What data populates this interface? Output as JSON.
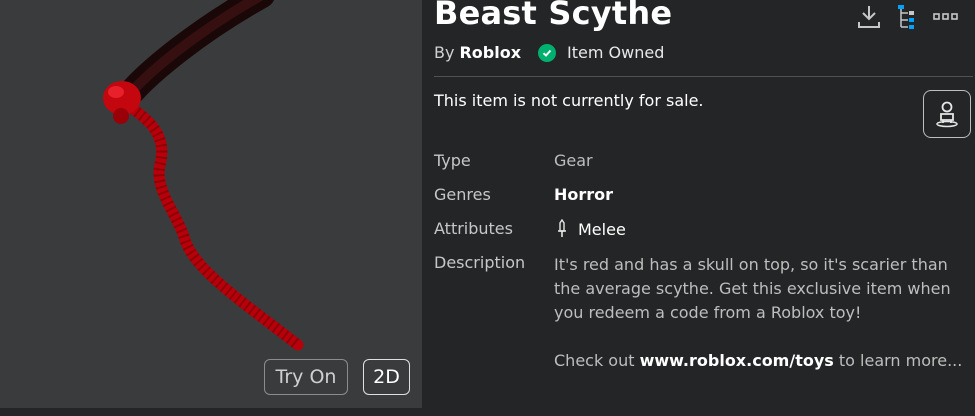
{
  "item": {
    "title": "Beast Scythe",
    "by_prefix": "By",
    "creator": "Roblox",
    "owned_label": "Item Owned",
    "sale_note": "This item is not currently for sale."
  },
  "preview": {
    "try_on_label": "Try On",
    "view_2d_label": "2D"
  },
  "details": {
    "type_label": "Type",
    "type_value": "Gear",
    "genres_label": "Genres",
    "genres_value": "Horror",
    "attributes_label": "Attributes",
    "attributes_value": "Melee",
    "description_label": "Description",
    "description_text": "It's red and has a skull on top, so it's scarier than the average scythe. Get this exclusive item when you redeem a code from a Roblox toy!",
    "more_prefix": "Check out ",
    "more_link": "www.roblox.com/toys",
    "more_suffix": " to learn more..."
  },
  "icons": {
    "download": "download-icon",
    "hierarchy": "hierarchy-icon",
    "more": "more-options-icon",
    "owned": "check-circle-icon",
    "avatar": "avatar-try-on-icon",
    "attribute": "melee-sword-icon"
  },
  "colors": {
    "background": "#232527",
    "preview_bg": "#393b3d",
    "owned_green": "#00b06f",
    "hierarchy_accent": "#00a2ff"
  }
}
